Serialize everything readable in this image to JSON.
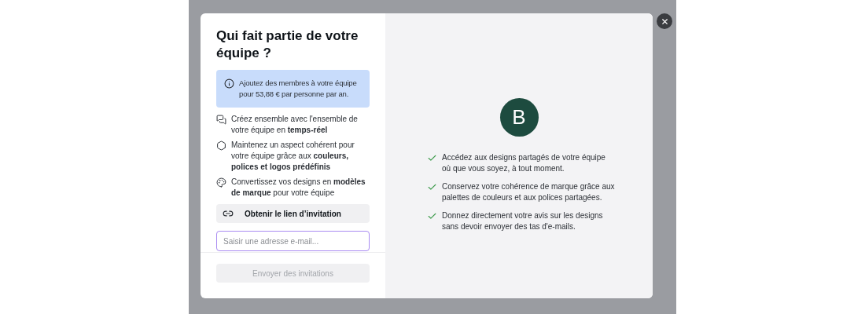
{
  "dialog": {
    "title": "Qui fait partie de votre équipe ?",
    "notice": "Ajoutez des membres à votre équipe pour 53,88 € par personne par an.",
    "features": [
      {
        "kind": "collab",
        "text": "Créez ensemble avec l'ensemble de votre équipe en **temps-réel**"
      },
      {
        "kind": "brand",
        "text": "Maintenez un aspect cohérent pour votre équipe grâce aux **couleurs, polices et logos prédéfinis**"
      },
      {
        "kind": "palette",
        "text": "Convertissez vos designs en **modèles de marque** pour votre équipe"
      }
    ],
    "link_button": "Obtenir le lien d’invitation",
    "email_field": {
      "placeholder": "Saisir une adresse e-mail..."
    },
    "send_button": {
      "label": "Envoyer des invitations",
      "disabled": true
    },
    "avatar": {
      "letter": "B",
      "color": "#1d4b3f"
    },
    "benefits": [
      "Accédez aux designs partagés de votre équipe où que vous soyez, à tout moment.",
      "Conservez votre cohérence de marque grâce aux palettes de couleurs et aux polices partagées.",
      "Donnez directement votre avis sur les designs sans devoir envoyer des tas d'e-mails."
    ]
  }
}
